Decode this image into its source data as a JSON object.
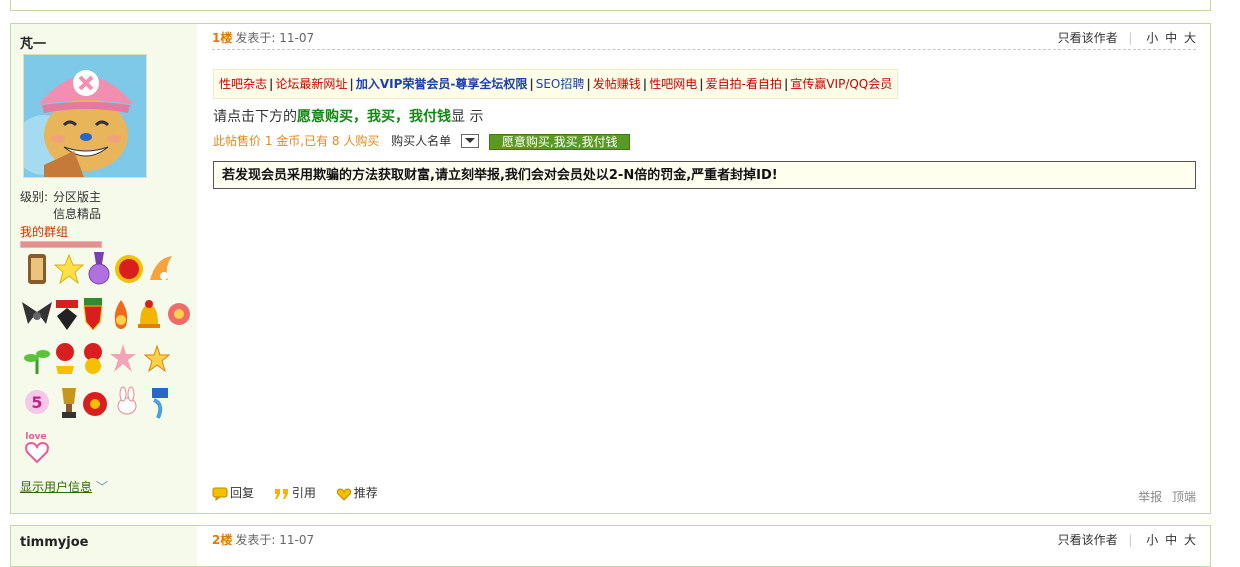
{
  "posts": [
    {
      "username": "芃一",
      "floor": "1楼",
      "time": "发表于: 11-07",
      "only_author": "只看该作者",
      "font_sizes": [
        "小",
        "中",
        "大"
      ],
      "level_label": "级别:",
      "level_value": "分区版主",
      "level_value2": "信息精品",
      "my_group": "我的群组",
      "ads": [
        {
          "text": "性吧杂志",
          "style": "red"
        },
        {
          "text": "论坛最新网址",
          "style": "red"
        },
        {
          "text": "加入VIP荣誉会员-尊享全坛权限",
          "style": "blue"
        },
        {
          "text": "SEO招聘",
          "style": "blue2"
        },
        {
          "text": "发帖赚钱",
          "style": "red"
        },
        {
          "text": "性吧网电",
          "style": "red"
        },
        {
          "text": "爱自拍-看自拍",
          "style": "red"
        },
        {
          "text": "宣传赢VIP/QQ会员",
          "style": "red"
        }
      ],
      "click_prefix": "请点击下方的",
      "click_green": "愿意购买，我买，我付钱",
      "click_suffix": "显 示",
      "sale_price": "此帖售价 1 金币,已有 8 人购买",
      "buyer_label": "购买人名单",
      "buy_button": "愿意购买,我买,我付钱",
      "notice": "若发现会员采用欺骗的方法获取财富,请立刻举报,我们会对会员处以2-N倍的罚金,严重者封掉ID!",
      "show_info": "显示用户信息",
      "reply": "回复",
      "quote": "引用",
      "recommend": "推荐",
      "report": "举报",
      "top": "顶端"
    },
    {
      "username": "timmyjoe",
      "floor": "2楼",
      "time": "发表于: 11-07",
      "only_author": "只看该作者",
      "font_sizes": [
        "小",
        "中",
        "大"
      ]
    }
  ],
  "colors": {
    "border": "#c2d9a3",
    "sidebar_bg": "#f5faeb",
    "floor": "#e07b00",
    "link_red": "#cc0000",
    "link_blue": "#1a3fb3",
    "green": "#118811"
  },
  "medals": [
    "scroll-medal",
    "star-medal",
    "purple-ribbon-medal",
    "red-seal-medal",
    "orange-flame-medal",
    "wings-medal",
    "black-cross-medal",
    "shield-medal",
    "flame-cup-medal",
    "bell-medal",
    "red-flower-medal",
    "green-plant-medal",
    "number-one-medal",
    "rose-2-medal",
    "star-burst-medal",
    "yellow-star-medal",
    "5-badge-medal",
    "trophy-medal",
    "hockey-puck-medal",
    "bunny-medal",
    "blue-flag-medal",
    "love-heart-medal"
  ]
}
